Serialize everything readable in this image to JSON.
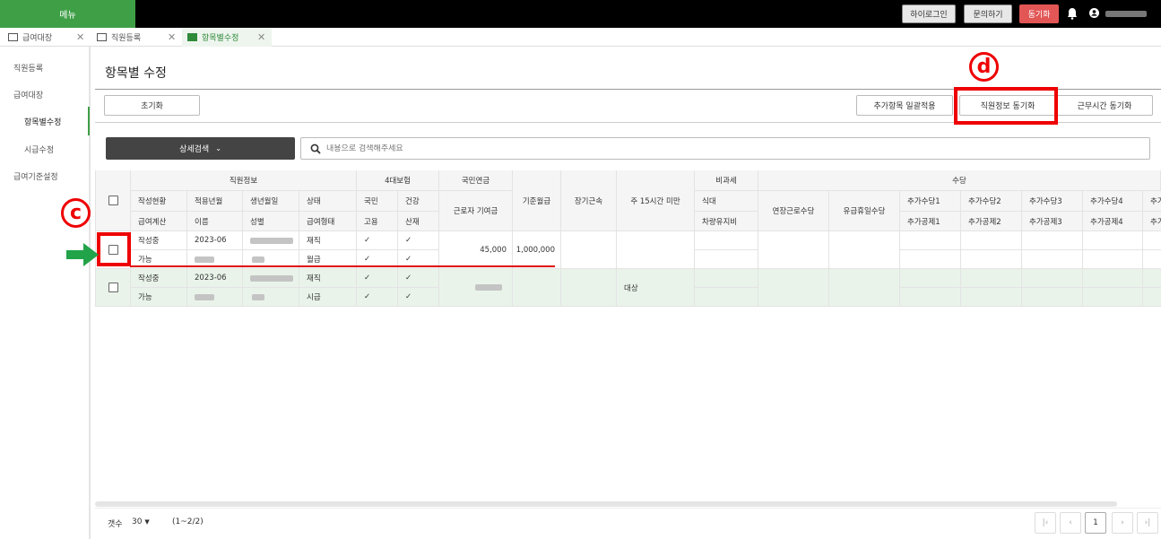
{
  "topbar": {
    "menu": "메뉴",
    "btn_relogin": "하이로그인",
    "btn_inquiry": "문의하기",
    "btn_sync": "동기화"
  },
  "tabs": [
    {
      "label": "급여대장"
    },
    {
      "label": "직원등록"
    },
    {
      "label": "항목별수정"
    }
  ],
  "sidebar": {
    "items": [
      {
        "label": "직원등록"
      },
      {
        "label": "급여대장"
      },
      {
        "label": "항목별수정"
      },
      {
        "label": "시급수정"
      },
      {
        "label": "급여기준설정"
      }
    ]
  },
  "page": {
    "title": "항목별 수정"
  },
  "toolbar": {
    "reset": "초기화",
    "bulk_apply": "추가항목 일괄적용",
    "sync_employee": "직원정보 동기화",
    "sync_worktime": "근무시간 동기화"
  },
  "search": {
    "detail_label": "상세검색",
    "placeholder": "내용으로 검색해주세요"
  },
  "table": {
    "group_headers": {
      "employee": "직원정보",
      "insurance": "4대보험",
      "pension": "국민연금",
      "nontax": "비과세",
      "allowance": "수당"
    },
    "h1": [
      "작성현황",
      "적용년월",
      "생년월일",
      "상태",
      "국민",
      "건강"
    ],
    "h2": [
      "급여계산",
      "이름",
      "성별",
      "급여형태",
      "고용",
      "산재"
    ],
    "pension_sub": "근로자 기여금",
    "base_salary": "기준월급",
    "long_service": "장기근속",
    "under15": "주 15시간 미만",
    "meal": "식대",
    "car": "차량유지비",
    "overtime": "연장근로수당",
    "holiday": "유급휴일수당",
    "add_allowance": [
      "추가수당1",
      "추가수당2",
      "추가수당3",
      "추가수당4",
      "추가"
    ],
    "add_deduction": [
      "추가공제1",
      "추가공제2",
      "추가공제3",
      "추가공제4",
      "추가"
    ],
    "rows": [
      {
        "status": "작성중",
        "calc": "가능",
        "ym": "2023-06",
        "emp_status": "재직",
        "pay_type": "월급",
        "ins": [
          "✓",
          "✓",
          "✓",
          "✓"
        ],
        "pension": "45,000",
        "base": "1,000,000",
        "under15": ""
      },
      {
        "status": "작성중",
        "calc": "가능",
        "ym": "2023-06",
        "emp_status": "재직",
        "pay_type": "시급",
        "ins": [
          "✓",
          "✓",
          "✓",
          "✓"
        ],
        "pension": "",
        "base": "",
        "under15": "대상"
      }
    ]
  },
  "annotations": {
    "c": "c",
    "d": "d"
  },
  "footer": {
    "count_label": "갯수",
    "count_value": "30",
    "range": "(1~2/2)",
    "page": "1"
  }
}
